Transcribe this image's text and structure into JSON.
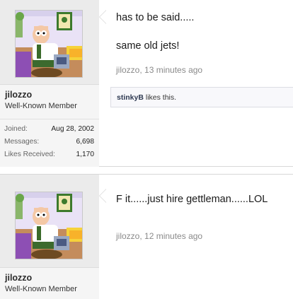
{
  "posts": [
    {
      "author": {
        "name": "jilozzo",
        "title": "Well-Known Member"
      },
      "stats": [
        {
          "label": "Joined:",
          "value": "Aug 28, 2002"
        },
        {
          "label": "Messages:",
          "value": "6,698"
        },
        {
          "label": "Likes Received:",
          "value": "1,170"
        }
      ],
      "message": [
        "has to be said.....",
        "same old jets!"
      ],
      "meta": {
        "author": "jilozzo",
        "time": "13 minutes ago"
      },
      "likes": {
        "user": "stinkyB",
        "text": " likes this."
      }
    },
    {
      "author": {
        "name": "jilozzo",
        "title": "Well-Known Member"
      },
      "message": [
        "F it......just hire gettleman......LOL"
      ],
      "meta": {
        "author": "jilozzo",
        "time": "12 minutes ago"
      }
    }
  ],
  "colors": {
    "sidebar": "#ebebeb",
    "link": "#2f3a52",
    "meta": "#8a8a8a"
  }
}
